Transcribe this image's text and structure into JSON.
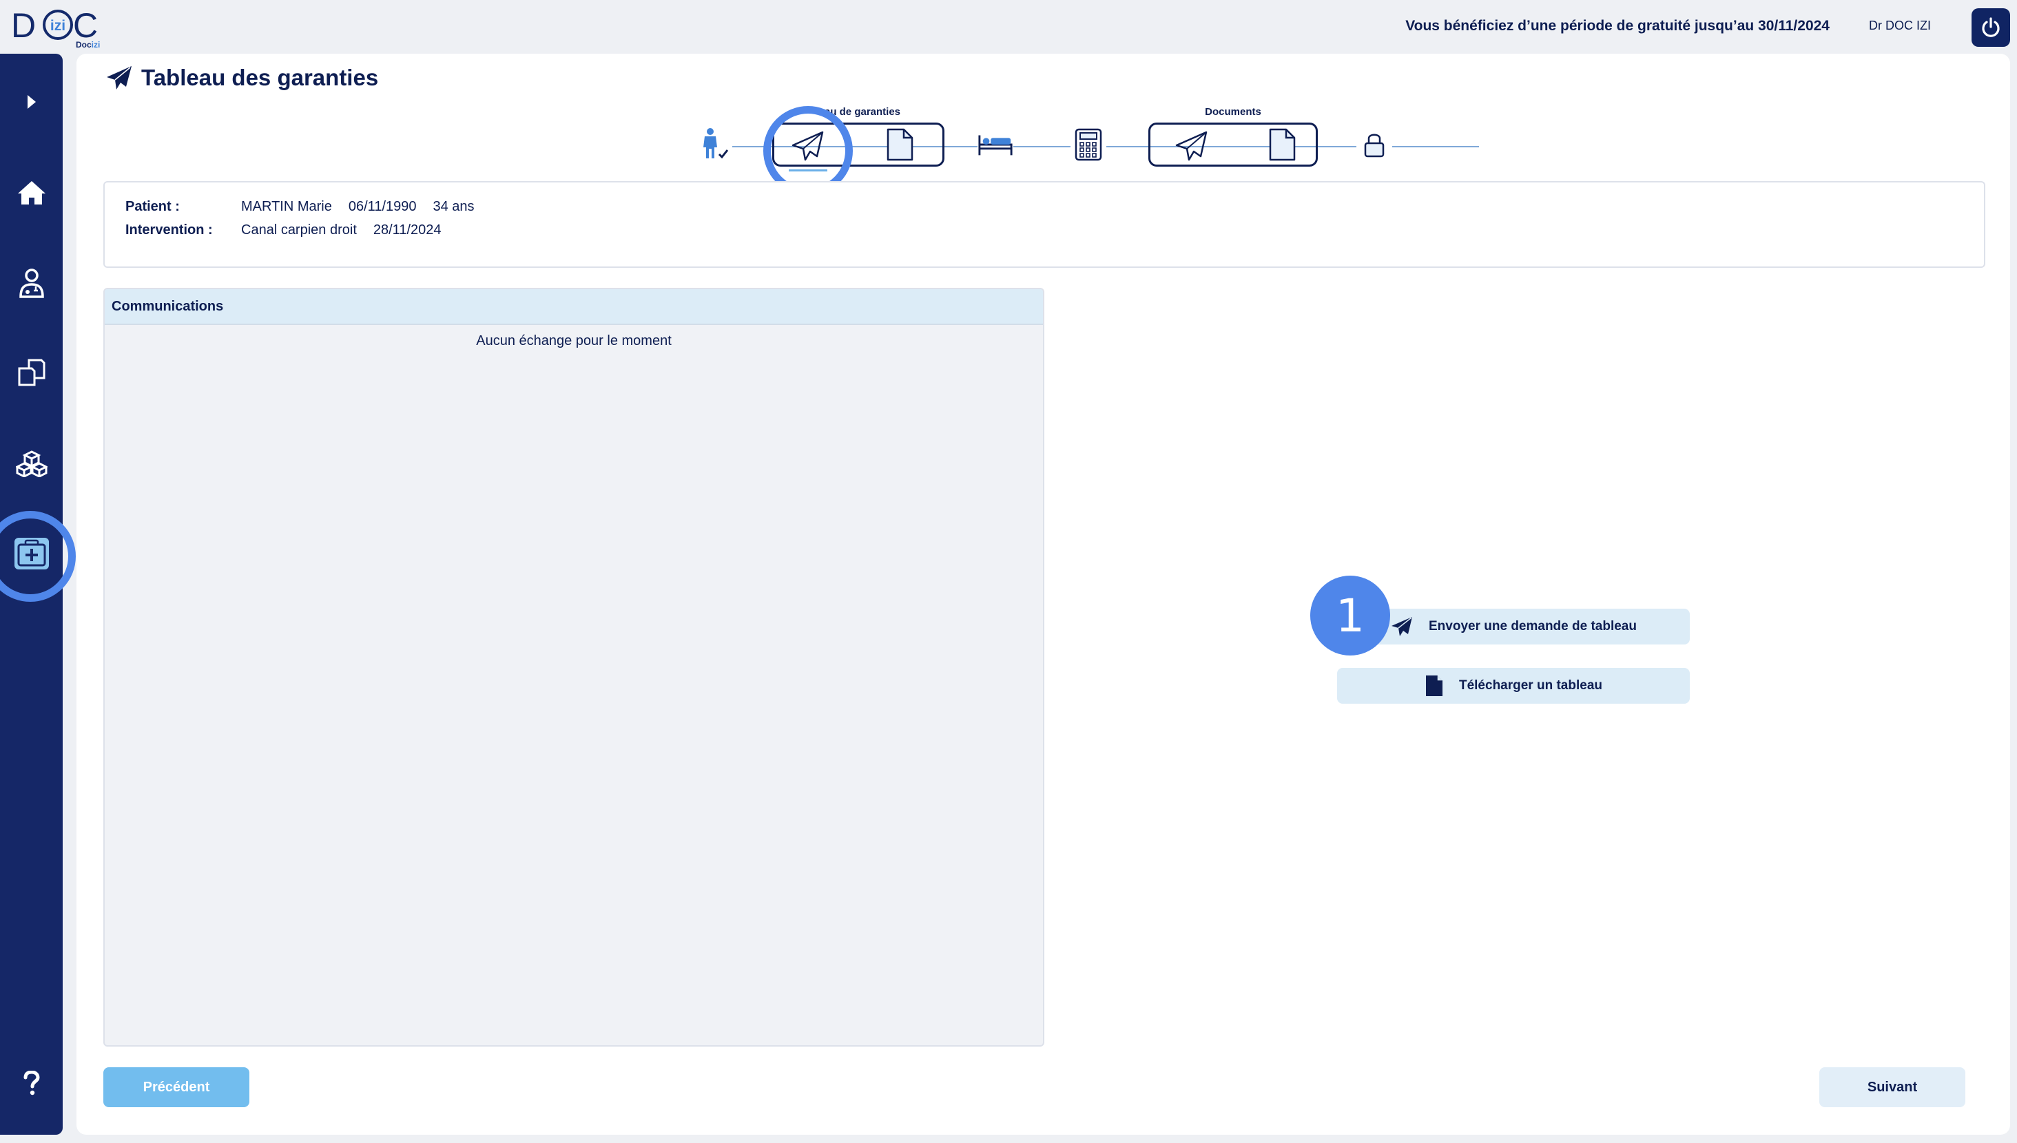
{
  "header": {
    "logo_text": "DOC",
    "logo_inner": "izi",
    "logo_sub": "Doc",
    "logo_sub_accent": "izi",
    "trial_notice": "Vous bénéficiez d’une période de gratuité jusqu’au 30/11/2024",
    "user_name": "Dr DOC IZI",
    "power_icon": "power-icon"
  },
  "sidebar": {
    "items": [
      {
        "name": "expand",
        "icon": "chevron-right-icon"
      },
      {
        "name": "home",
        "icon": "home-icon"
      },
      {
        "name": "doctor",
        "icon": "doctor-icon"
      },
      {
        "name": "documents",
        "icon": "documents-icon"
      },
      {
        "name": "boxes",
        "icon": "boxes-icon"
      },
      {
        "name": "medical-case",
        "icon": "medical-case-icon",
        "active": true
      },
      {
        "name": "help",
        "icon": "help-icon"
      }
    ]
  },
  "page": {
    "title": "Tableau des garanties",
    "title_icon": "paper-plane-icon"
  },
  "stepper": {
    "group1_label": "au de garanties",
    "group2_label": "Documents",
    "steps": [
      "patient-icon",
      "paper-plane-icon",
      "document-icon",
      "bed-icon",
      "calculator-icon",
      "paper-plane-icon",
      "document-icon",
      "lock-icon"
    ]
  },
  "patient": {
    "patient_label": "Patient :",
    "name": "MARTIN Marie",
    "birthdate": "06/11/1990",
    "age": "34 ans",
    "intervention_label": "Intervention :",
    "intervention": "Canal carpien droit",
    "intervention_date": "28/11/2024"
  },
  "communications": {
    "title": "Communications",
    "empty_text": "Aucun échange pour le moment"
  },
  "actions": {
    "badge": "1",
    "send_request": "Envoyer une demande de tableau",
    "upload": "Télécharger un tableau"
  },
  "nav": {
    "previous": "Précédent",
    "next": "Suivant"
  },
  "colors": {
    "navy": "#152767",
    "accent_ring": "#4f86ea",
    "light_blue": "#dcecf7",
    "prev_button": "#72bdee"
  }
}
